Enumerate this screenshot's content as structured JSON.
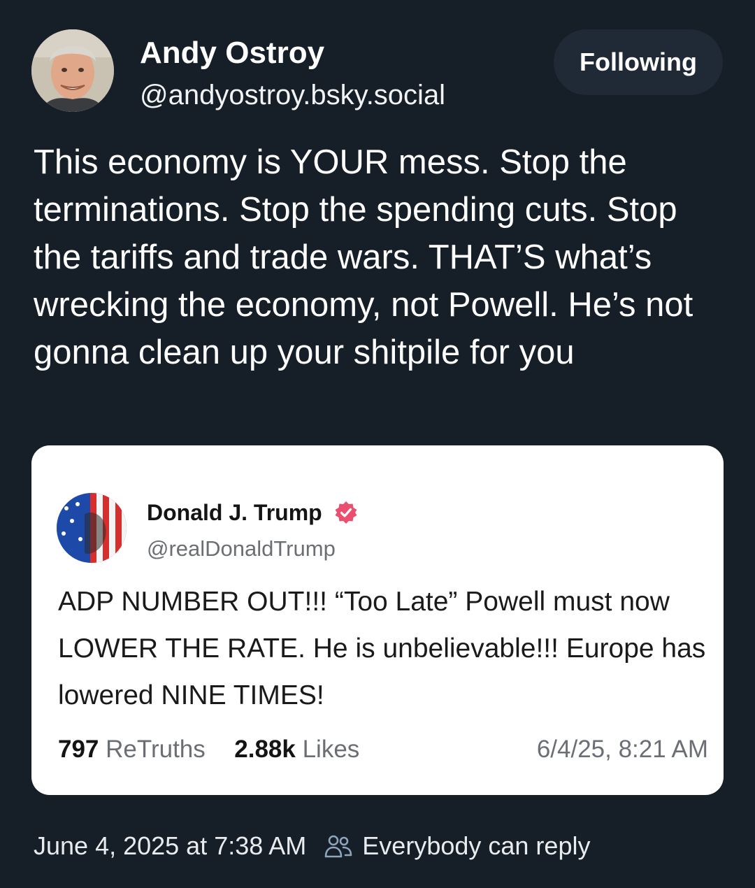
{
  "author": {
    "name": "Andy Ostroy",
    "handle": "@andyostroy.bsky.social",
    "avatar_icon": "profile-photo"
  },
  "follow_button": {
    "label": "Following"
  },
  "post": {
    "text": "This economy is YOUR mess. Stop the terminations. Stop the spending cuts. Stop the tariffs and trade wars. THAT’S what’s wrecking the economy, not Powell. He’s not gonna clean up your shitpile for you"
  },
  "embed": {
    "name": "Donald J. Trump",
    "handle": "@realDonaldTrump",
    "verified_color": "#ea4f6f",
    "text": "ADP NUMBER OUT!!! “Too Late” Powell must now LOWER THE RATE. He is unbelievable!!! Europe has lowered NINE TIMES!",
    "retruths_count": "797",
    "retruths_label": "ReTruths",
    "likes_count": "2.88k",
    "likes_label": "Likes",
    "timestamp": "6/4/25, 8:21 AM"
  },
  "footer": {
    "date": "June 4, 2025 at 7:38 AM",
    "reply_icon": "people-icon",
    "reply_setting": "Everybody can reply"
  },
  "colors": {
    "background": "#161e27",
    "button_bg": "#1f2a36",
    "card_bg": "#ffffff",
    "muted_text": "#6b6f75"
  }
}
